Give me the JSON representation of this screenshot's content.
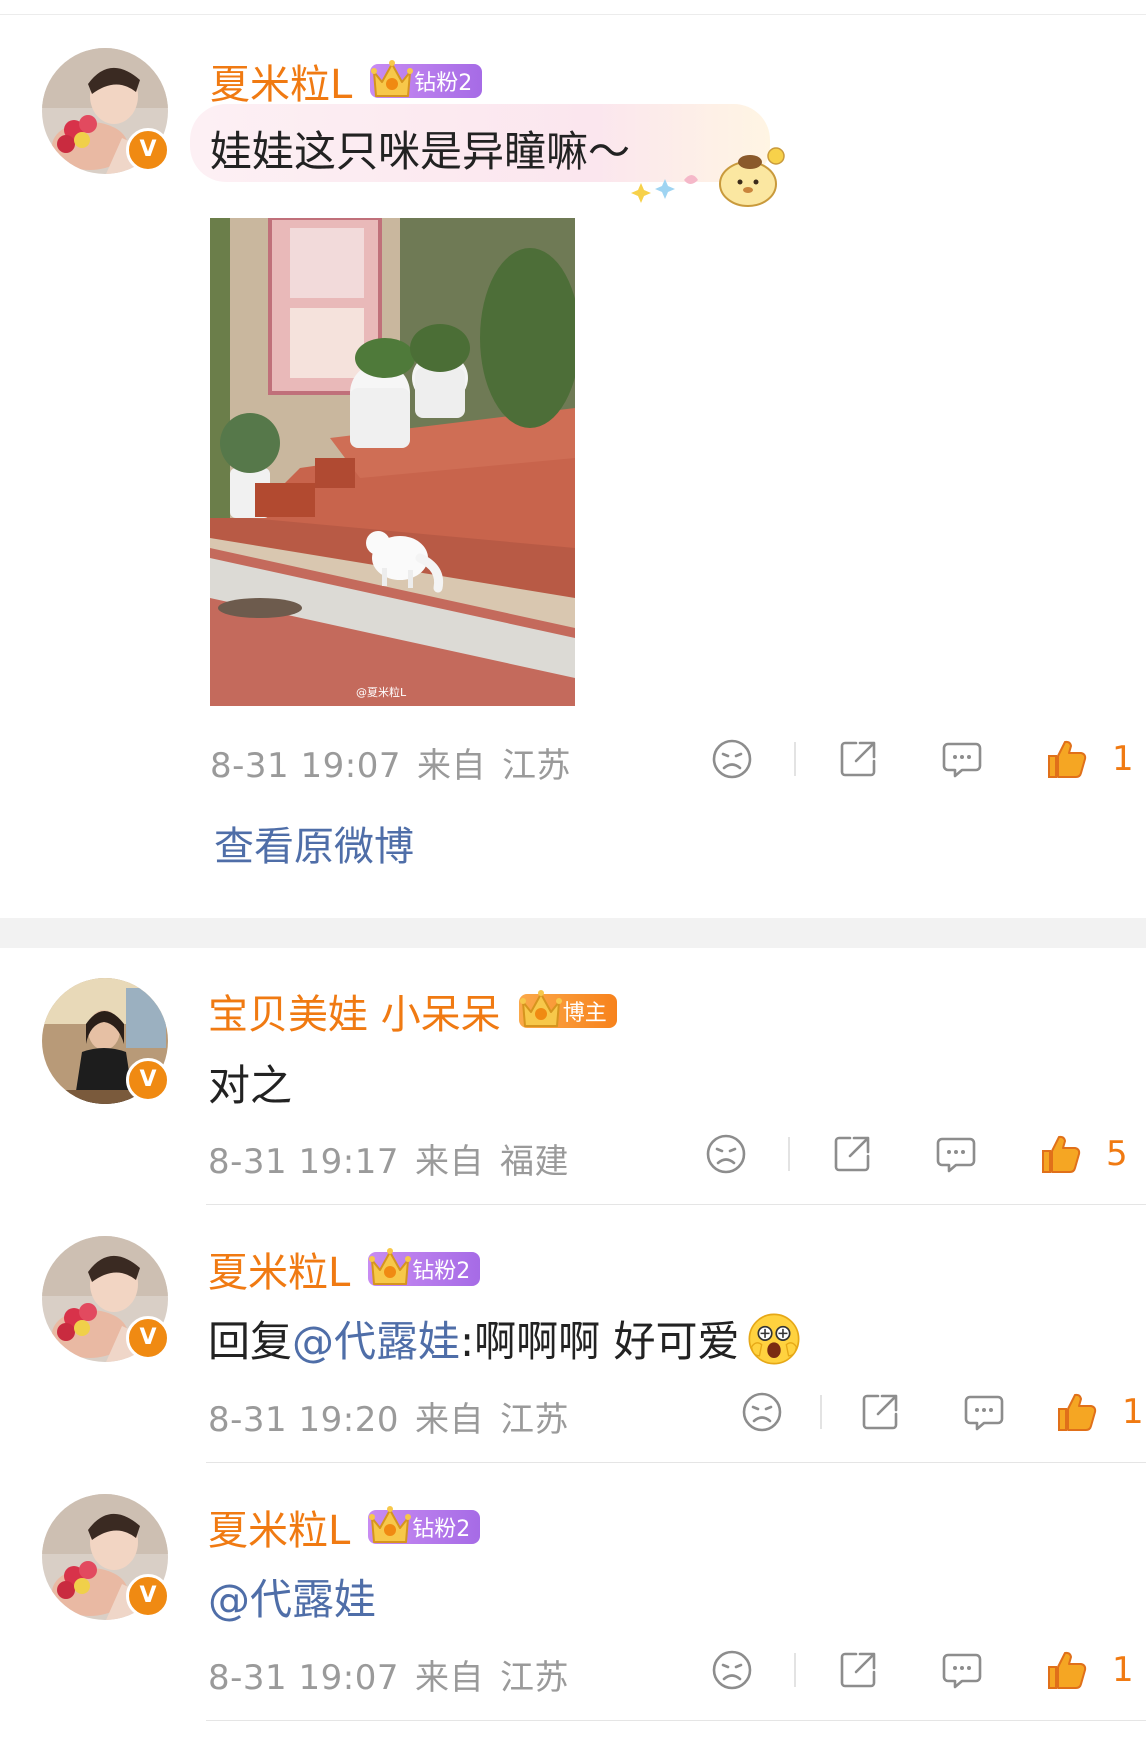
{
  "comments": [
    {
      "username": "夏米粒L",
      "badge": "钻粉2",
      "text": "娃娃这只咪是异瞳嘛～",
      "time": "8-31 19:07",
      "from": "来自",
      "location": "江苏",
      "likes": "1",
      "photo_watermark": "@夏米粒L",
      "view_original": "查看原微博"
    },
    {
      "username": "宝贝美娃 小呆呆",
      "badge": "博主",
      "text": "对之",
      "time": "8-31 19:17",
      "from": "来自",
      "location": "福建",
      "likes": "5"
    },
    {
      "username": "夏米粒L",
      "badge": "钻粉2",
      "reply_prefix": "回复",
      "mention": "@代露娃",
      "text_after": ":啊啊啊 好可爱",
      "time": "8-31 19:20",
      "from": "来自",
      "location": "江苏",
      "likes": "1"
    },
    {
      "username": "夏米粒L",
      "badge": "钻粉2",
      "mention": "@代露娃",
      "time": "8-31 19:07",
      "from": "来自",
      "location": "江苏",
      "likes": "1"
    }
  ],
  "verified_mark": "V",
  "colors": {
    "username": "#f07a12",
    "mention": "#4f6ea8",
    "meta": "#9a9a9a",
    "like": "#f07a12"
  },
  "icons": [
    "dislike-face-icon",
    "share-icon",
    "comment-icon",
    "thumbs-up-icon",
    "shocked-emoji-icon"
  ]
}
